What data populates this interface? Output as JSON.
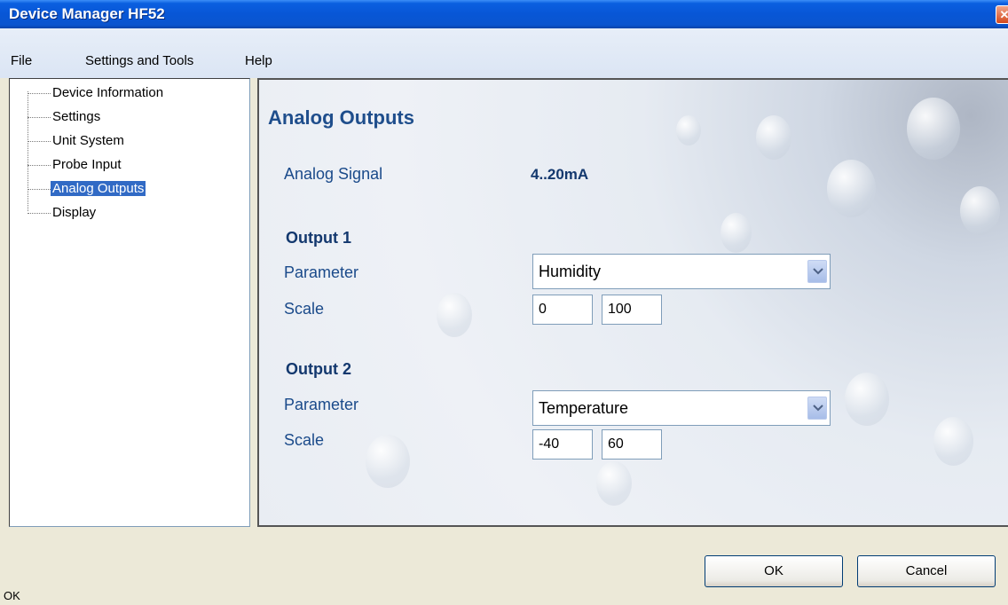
{
  "window": {
    "title": "Device Manager HF52",
    "close_glyph": "✕"
  },
  "menu": {
    "items": [
      {
        "label": "File"
      },
      {
        "label": "Settings and Tools"
      },
      {
        "label": "Help"
      }
    ]
  },
  "tree": {
    "items": [
      {
        "label": "Device Information",
        "selected": false
      },
      {
        "label": "Settings",
        "selected": false
      },
      {
        "label": "Unit System",
        "selected": false
      },
      {
        "label": "Probe Input",
        "selected": false
      },
      {
        "label": "Analog Outputs",
        "selected": true
      },
      {
        "label": "Display",
        "selected": false
      }
    ]
  },
  "panel": {
    "heading": "Analog Outputs",
    "analog_signal_label": "Analog Signal",
    "analog_signal_value": "4..20mA",
    "output1": {
      "title": "Output 1",
      "parameter_label": "Parameter",
      "parameter_value": "Humidity",
      "scale_label": "Scale",
      "scale_min": "0",
      "scale_max": "100"
    },
    "output2": {
      "title": "Output 2",
      "parameter_label": "Parameter",
      "parameter_value": "Temperature",
      "scale_label": "Scale",
      "scale_min": "-40",
      "scale_max": "60"
    }
  },
  "buttons": {
    "ok": "OK",
    "cancel": "Cancel"
  },
  "status": {
    "text": "OK"
  }
}
